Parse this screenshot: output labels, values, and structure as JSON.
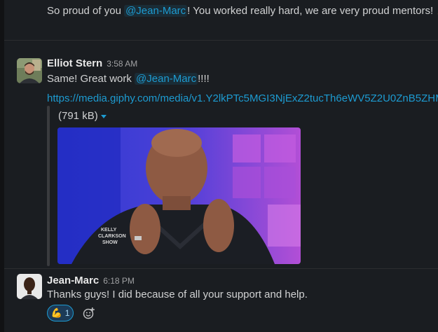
{
  "message1": {
    "prefix": "So proud of you ",
    "mention": "@Jean-Marc",
    "suffix": "! You worked really hard, we are very proud mentors!",
    "emoji": "💪"
  },
  "message2": {
    "author": "Elliot Stern",
    "time": "3:58 AM",
    "prefix": "Same! Great work ",
    "mention": "@Jean-Marc",
    "suffix": "!!!!",
    "link": "https://media.giphy.com/media/v1.Y2lkPTc5MGI3NjExZ2tucTh6eWV5Z2U0ZnB5ZHMy",
    "attachment_size": "(791 kB)",
    "gif_overlay_text_line1": "KELLY",
    "gif_overlay_text_line2": "CLARKSON",
    "gif_overlay_text_line3": "SHOW"
  },
  "message3": {
    "author": "Jean-Marc",
    "time": "6:18 PM",
    "text": "Thanks guys! I did because of all your support and help.",
    "reaction_emoji": "💪",
    "reaction_count": "1"
  },
  "icons": {
    "caret": "chevron-down-icon",
    "add_reaction": "add-reaction-icon"
  },
  "colors": {
    "background": "#1a1d21",
    "link": "#1d9bd1",
    "reaction_bg": "#1c3a57"
  }
}
